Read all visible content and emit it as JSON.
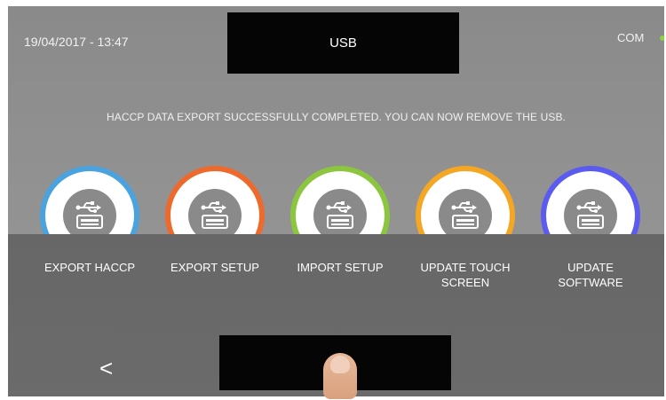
{
  "header": {
    "datetime": "19/04/2017 - 13:47",
    "title": "USB",
    "com_label": "COM",
    "com_status_color": "#8ed040"
  },
  "message": "HACCP DATA EXPORT SUCCESSFULLY COMPLETED. YOU CAN NOW REMOVE THE USB.",
  "options": [
    {
      "label": "EXPORT HACCP",
      "ring_color": "#4aa3df",
      "icon": "usb-icon"
    },
    {
      "label": "EXPORT SETUP",
      "ring_color": "#ee6a2c",
      "icon": "usb-icon"
    },
    {
      "label": "IMPORT SETUP",
      "ring_color": "#8cc63f",
      "icon": "usb-icon"
    },
    {
      "label": "UPDATE TOUCH SCREEN",
      "ring_color": "#f5a623",
      "icon": "usb-icon"
    },
    {
      "label": "UPDATE SOFTWARE",
      "ring_color": "#5b5bf0",
      "icon": "usb-icon"
    }
  ],
  "footer": {
    "back_glyph": "<"
  }
}
